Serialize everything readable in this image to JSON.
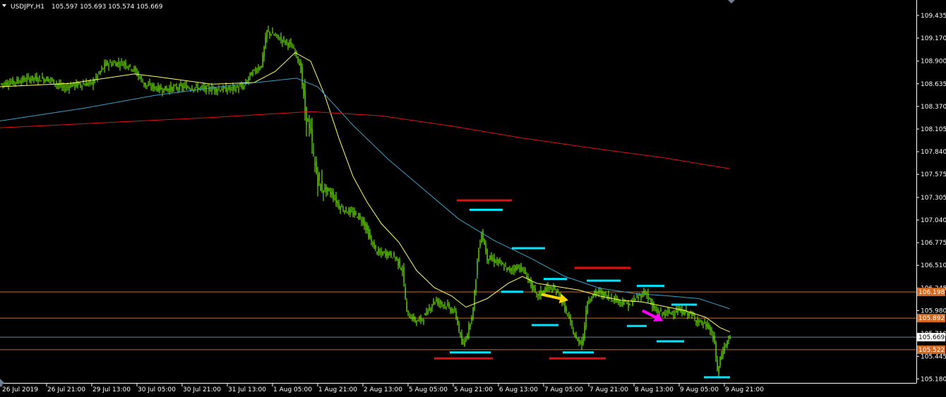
{
  "header": {
    "symbol": "USDJPY,H1",
    "ohlc": "105.597 105.693 105.574 105.669"
  },
  "colors": {
    "background": "#000000",
    "candle": "#7CFC00",
    "ma_fast": "#ffff66",
    "ma_mid": "#3aa0c8",
    "ma_slow": "#e01010",
    "level_line": "#d2691e",
    "level_tag": "#d2691e",
    "current_tag": "#ffffff",
    "marker_high": "#e01010",
    "marker_cyan": "#00e5ff",
    "arrow_yellow": "#ffd700",
    "arrow_magenta": "#ff00ff",
    "axis_text": "#ffffff"
  },
  "chart_data": {
    "type": "candlestick",
    "symbol": "USDJPY",
    "timeframe": "H1",
    "ylim": [
      105.15,
      109.5
    ],
    "y_ticks": [
      "109.435",
      "109.170",
      "108.900",
      "108.635",
      "108.370",
      "108.105",
      "107.840",
      "107.575",
      "107.305",
      "107.040",
      "106.775",
      "106.510",
      "106.245",
      "105.980",
      "105.710",
      "105.445",
      "105.180"
    ],
    "x_ticks": [
      "26 Jul 2019",
      "26 Jul 21:00",
      "29 Jul 13:00",
      "30 Jul 05:00",
      "30 Jul 21:00",
      "31 Jul 13:00",
      "1 Aug 05:00",
      "1 Aug 21:00",
      "2 Aug 13:00",
      "5 Aug 05:00",
      "5 Aug 21:00",
      "6 Aug 13:00",
      "7 Aug 05:00",
      "7 Aug 21:00",
      "8 Aug 13:00",
      "9 Aug 05:00",
      "9 Aug 21:00"
    ],
    "price_path": [
      [
        0,
        108.63
      ],
      [
        25,
        108.67
      ],
      [
        45,
        108.7
      ],
      [
        70,
        108.69
      ],
      [
        90,
        108.58
      ],
      [
        100,
        108.62
      ],
      [
        130,
        108.64
      ],
      [
        150,
        108.87
      ],
      [
        175,
        108.88
      ],
      [
        190,
        108.8
      ],
      [
        205,
        108.62
      ],
      [
        230,
        108.57
      ],
      [
        260,
        108.6
      ],
      [
        290,
        108.58
      ],
      [
        320,
        108.57
      ],
      [
        345,
        108.6
      ],
      [
        355,
        108.75
      ],
      [
        370,
        108.85
      ],
      [
        378,
        109.25
      ],
      [
        395,
        109.17
      ],
      [
        410,
        109.1
      ],
      [
        420,
        108.98
      ],
      [
        426,
        108.8
      ],
      [
        432,
        108.3
      ],
      [
        440,
        108.05
      ],
      [
        445,
        107.7
      ],
      [
        452,
        107.45
      ],
      [
        460,
        107.4
      ],
      [
        470,
        107.35
      ],
      [
        480,
        107.2
      ],
      [
        490,
        107.15
      ],
      [
        505,
        107.1
      ],
      [
        515,
        107.02
      ],
      [
        525,
        106.8
      ],
      [
        535,
        106.65
      ],
      [
        550,
        106.65
      ],
      [
        560,
        106.6
      ],
      [
        570,
        106.45
      ],
      [
        576,
        105.95
      ],
      [
        590,
        105.85
      ],
      [
        600,
        105.9
      ],
      [
        615,
        106.1
      ],
      [
        630,
        106.05
      ],
      [
        645,
        105.95
      ],
      [
        655,
        105.55
      ],
      [
        663,
        105.75
      ],
      [
        670,
        106.0
      ],
      [
        677,
        106.65
      ],
      [
        682,
        106.9
      ],
      [
        690,
        106.6
      ],
      [
        705,
        106.55
      ],
      [
        720,
        106.45
      ],
      [
        735,
        106.5
      ],
      [
        745,
        106.4
      ],
      [
        760,
        106.15
      ],
      [
        775,
        106.25
      ],
      [
        790,
        106.2
      ],
      [
        805,
        105.9
      ],
      [
        815,
        105.65
      ],
      [
        825,
        105.6
      ],
      [
        832,
        106.1
      ],
      [
        845,
        106.2
      ],
      [
        860,
        106.15
      ],
      [
        875,
        106.1
      ],
      [
        890,
        106.05
      ],
      [
        905,
        106.15
      ],
      [
        915,
        106.2
      ],
      [
        925,
        106.0
      ],
      [
        935,
        105.95
      ],
      [
        945,
        105.95
      ],
      [
        960,
        105.98
      ],
      [
        975,
        105.95
      ],
      [
        990,
        105.85
      ],
      [
        1005,
        105.78
      ],
      [
        1012,
        105.6
      ],
      [
        1016,
        105.25
      ],
      [
        1022,
        105.48
      ],
      [
        1030,
        105.62
      ],
      [
        1034,
        105.669
      ]
    ],
    "last_price": "105.669",
    "moving_averages": [
      {
        "color": "#ffff66",
        "points": [
          [
            0,
            108.6
          ],
          [
            100,
            108.64
          ],
          [
            190,
            108.75
          ],
          [
            220,
            108.72
          ],
          [
            300,
            108.63
          ],
          [
            360,
            108.65
          ],
          [
            390,
            108.78
          ],
          [
            418,
            109.0
          ],
          [
            440,
            108.9
          ],
          [
            460,
            108.5
          ],
          [
            480,
            108.0
          ],
          [
            500,
            107.55
          ],
          [
            520,
            107.25
          ],
          [
            540,
            107.0
          ],
          [
            565,
            106.78
          ],
          [
            590,
            106.45
          ],
          [
            615,
            106.25
          ],
          [
            640,
            106.15
          ],
          [
            660,
            106.02
          ],
          [
            690,
            106.12
          ],
          [
            720,
            106.3
          ],
          [
            740,
            106.38
          ],
          [
            760,
            106.3
          ],
          [
            790,
            106.26
          ],
          [
            820,
            106.22
          ],
          [
            850,
            106.15
          ],
          [
            880,
            106.1
          ],
          [
            910,
            106.08
          ],
          [
            940,
            106.03
          ],
          [
            970,
            105.98
          ],
          [
            1000,
            105.9
          ],
          [
            1020,
            105.78
          ],
          [
            1034,
            105.73
          ]
        ]
      },
      {
        "color": "#3aa0c8",
        "points": [
          [
            0,
            108.2
          ],
          [
            120,
            108.35
          ],
          [
            220,
            108.5
          ],
          [
            330,
            108.62
          ],
          [
            420,
            108.7
          ],
          [
            450,
            108.6
          ],
          [
            500,
            108.15
          ],
          [
            550,
            107.75
          ],
          [
            600,
            107.4
          ],
          [
            650,
            107.05
          ],
          [
            700,
            106.8
          ],
          [
            750,
            106.6
          ],
          [
            800,
            106.38
          ],
          [
            850,
            106.24
          ],
          [
            900,
            106.18
          ],
          [
            950,
            106.15
          ],
          [
            990,
            106.12
          ],
          [
            1034,
            106.0
          ]
        ]
      },
      {
        "color": "#e01010",
        "points": [
          [
            0,
            108.12
          ],
          [
            150,
            108.18
          ],
          [
            300,
            108.24
          ],
          [
            440,
            108.31
          ],
          [
            540,
            108.26
          ],
          [
            640,
            108.14
          ],
          [
            740,
            108.0
          ],
          [
            840,
            107.88
          ],
          [
            940,
            107.77
          ],
          [
            1034,
            107.64
          ]
        ]
      }
    ],
    "horizontal_levels": [
      {
        "price": 106.198,
        "label": "106.198"
      },
      {
        "price": 105.892,
        "label": "105.892"
      },
      {
        "price": 105.522,
        "label": "105.522"
      }
    ],
    "current_price_line": {
      "price": 105.669,
      "label": "105.669"
    },
    "marked_highs": [
      {
        "color": "#e01010",
        "price": 107.27,
        "x0": 647,
        "x1": 725
      },
      {
        "color": "#e01010",
        "price": 106.48,
        "x0": 814,
        "x1": 893
      },
      {
        "color": "#e01010",
        "price": 105.42,
        "x0": 615,
        "x1": 698
      },
      {
        "color": "#e01010",
        "price": 105.42,
        "x0": 778,
        "x1": 858
      }
    ],
    "marked_levels_cyan": [
      {
        "price": 107.16,
        "x0": 665,
        "x1": 712
      },
      {
        "price": 106.71,
        "x0": 725,
        "x1": 772
      },
      {
        "price": 106.35,
        "x0": 770,
        "x1": 803
      },
      {
        "price": 106.33,
        "x0": 831,
        "x1": 879
      },
      {
        "price": 106.27,
        "x0": 902,
        "x1": 941
      },
      {
        "price": 106.2,
        "x0": 710,
        "x1": 741
      },
      {
        "price": 106.05,
        "x0": 951,
        "x1": 987
      },
      {
        "price": 105.81,
        "x0": 753,
        "x1": 791
      },
      {
        "price": 105.8,
        "x0": 888,
        "x1": 916
      },
      {
        "price": 105.62,
        "x0": 930,
        "x1": 969
      },
      {
        "price": 105.49,
        "x0": 637,
        "x1": 695
      },
      {
        "price": 105.49,
        "x0": 797,
        "x1": 841
      },
      {
        "price": 105.2,
        "x0": 997,
        "x1": 1034
      }
    ],
    "arrows": [
      {
        "color": "#ffd700",
        "x0": 767,
        "y0": 106.17,
        "x1": 805,
        "y1": 106.1
      },
      {
        "color": "#ff00ff",
        "x0": 910,
        "y0": 105.98,
        "x1": 939,
        "y1": 105.86
      }
    ]
  }
}
